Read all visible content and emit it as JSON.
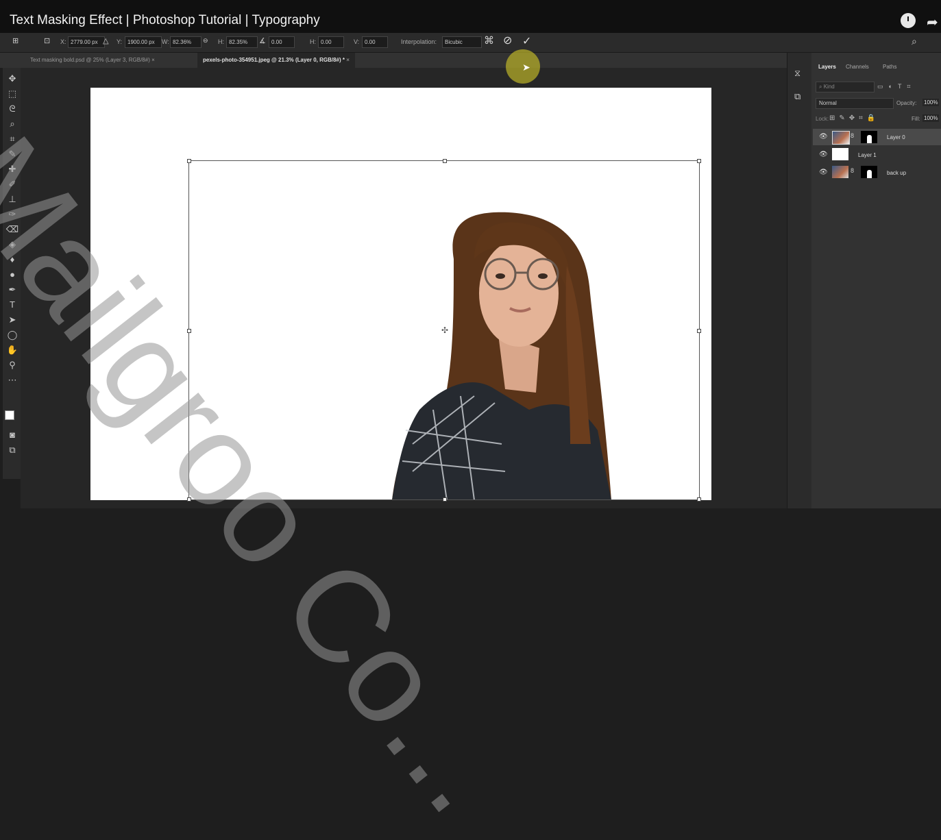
{
  "video": {
    "title": "Text Masking Effect | Photoshop Tutorial | Typography"
  },
  "options_bar": {
    "x_label": "X:",
    "x_value": "2779.00 px",
    "y_label": "Y:",
    "y_value": "1900.00 px",
    "w_label": "W:",
    "w_value": "82.36%",
    "h_label": "H:",
    "h_value": "82.35%",
    "angle_value": "0.00",
    "hskew_label": "H:",
    "hskew_value": "0.00",
    "vskew_label": "V:",
    "vskew_value": "0.00",
    "interpolation_label": "Interpolation:",
    "interpolation_value": "Bicubic"
  },
  "tabs": [
    {
      "label": "Text masking bold.psd @ 25% (Layer 3, RGB/8#)"
    },
    {
      "label": "pexels-photo-354951.jpeg @ 21.3% (Layer 0, RGB/8#) *"
    }
  ],
  "panel": {
    "tabs": [
      "Layers",
      "Channels",
      "Paths"
    ],
    "filter_placeholder": "Kind",
    "blend_mode": "Normal",
    "opacity_label": "Opacity:",
    "opacity_value": "100%",
    "lock_label": "Lock:",
    "fill_label": "Fill:",
    "fill_value": "100%",
    "layers": [
      {
        "name": "Layer 0"
      },
      {
        "name": "Layer 1"
      },
      {
        "name": "back up"
      }
    ]
  },
  "watermark": "Mailgroo Co...",
  "colors": {
    "accent": "#c8be28",
    "canvas": "#ffffff",
    "ui_dark": "#2b2b2b"
  }
}
